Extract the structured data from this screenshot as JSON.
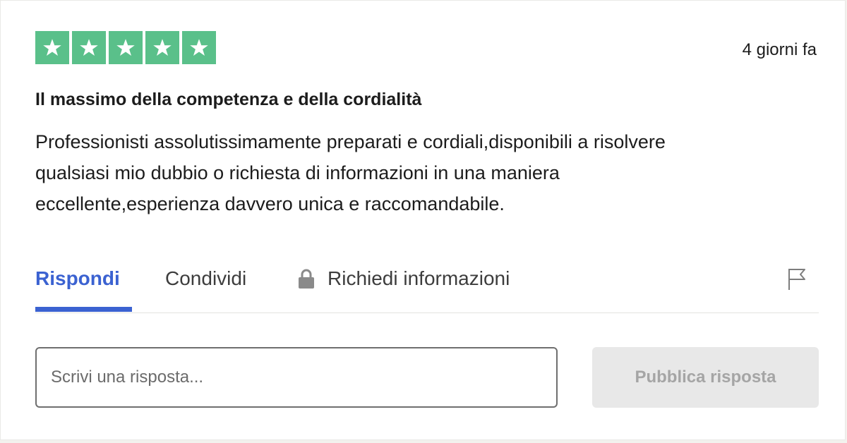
{
  "review": {
    "rating": 5,
    "max_rating": 5,
    "star_color": "#5ac08a",
    "date": "4 giorni fa",
    "title": "Il massimo della competenza e della cordialità",
    "text_lines": [
      "Professionisti assolutissimamente preparati e cordiali,disponibili a risolvere",
      "qualsiasi mio dubbio o richiesta di informazioni in una maniera",
      "eccellente,esperienza davvero unica e raccomandabile."
    ]
  },
  "tabs": [
    {
      "label": "Rispondi",
      "active": true
    },
    {
      "label": "Condividi",
      "active": false
    },
    {
      "label": "Richiedi informazioni",
      "active": false,
      "icon": "lock-icon"
    }
  ],
  "flag_icon": "flag-icon",
  "accent_color": "#3b62d1",
  "reply": {
    "placeholder": "Scrivi una risposta...",
    "value": "",
    "publish_label": "Pubblica risposta",
    "publish_enabled": false
  }
}
